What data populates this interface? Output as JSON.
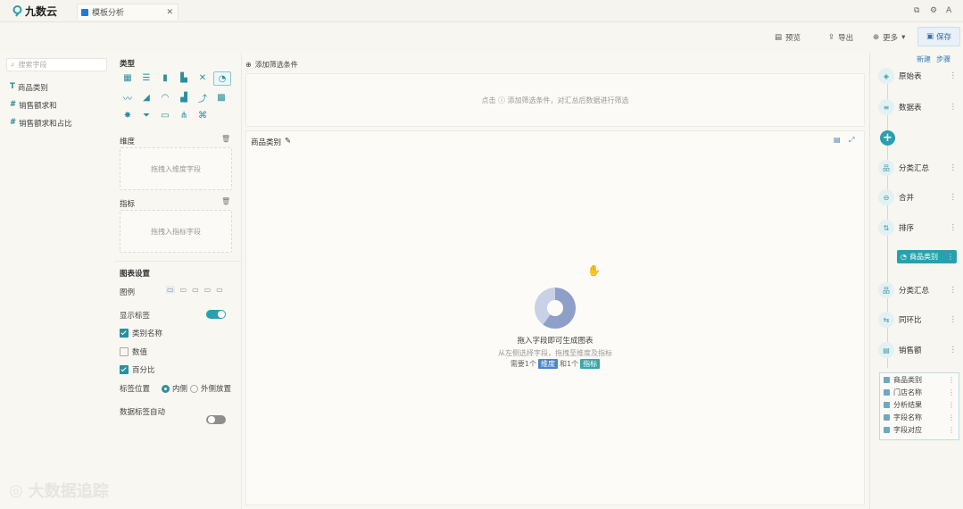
{
  "app": {
    "logo_text": "九数云"
  },
  "tab": {
    "title": "模板分析"
  },
  "window_icons": [
    "pin-icon",
    "settings-icon",
    "user-icon"
  ],
  "toolbar": {
    "preview": "预览",
    "export": "导出",
    "more": "更多",
    "save": "保存"
  },
  "fields": {
    "search_placeholder": "搜索字段",
    "items": [
      {
        "type": "T",
        "name": "商品类别"
      },
      {
        "type": "#",
        "name": "销售额求和"
      },
      {
        "type": "#",
        "name": "销售额求和占比"
      }
    ]
  },
  "config": {
    "type_title": "类型",
    "dimension_title": "维度",
    "dimension_placeholder": "拖拽入维度字段",
    "value_title": "指标",
    "value_placeholder": "拖拽入指标字段",
    "chart_settings_title": "图表设置",
    "layout_label": "图例",
    "show_labels": "显示标签",
    "cb_category": "类别名称",
    "cb_value": "数值",
    "cb_percent": "百分比",
    "label_pos_label": "标签位置",
    "radio_inside": "内侧",
    "radio_outside": "外侧放置",
    "auto_refresh": "数据标签自动"
  },
  "filter": {
    "add_label": "添加筛选条件",
    "empty_hint": "点击 ⓘ 添加筛选条件，对汇总后数据进行筛选"
  },
  "chart": {
    "title": "商品类别",
    "empty_title": "拖入字段即可生成图表",
    "empty_sub": "从左侧选择字段，拖拽至维度及指标",
    "empty_req_prefix": "需要1个",
    "empty_req_dim": "维度",
    "empty_req_mid": "和1个",
    "empty_req_val": "指标"
  },
  "flow": {
    "header_left": "新建",
    "header_right": "步骤",
    "nodes": [
      {
        "label": "原始表",
        "icon": "source-icon"
      },
      {
        "label": "数据表",
        "icon": "table-icon"
      },
      {
        "label": "分类汇总",
        "icon": "group-icon"
      },
      {
        "label": "合并",
        "icon": "merge-icon"
      },
      {
        "label": "排序",
        "icon": "sort-icon"
      },
      {
        "label": "分类汇总",
        "icon": "group-icon"
      },
      {
        "label": "同环比",
        "icon": "compare-icon"
      },
      {
        "label": "销售额",
        "icon": "sales-icon"
      }
    ],
    "active": "商品类别",
    "list": [
      "商品类别",
      "门店名称",
      "分析结果",
      "字段名称",
      "字段对应"
    ]
  },
  "watermark": "大数据追踪"
}
